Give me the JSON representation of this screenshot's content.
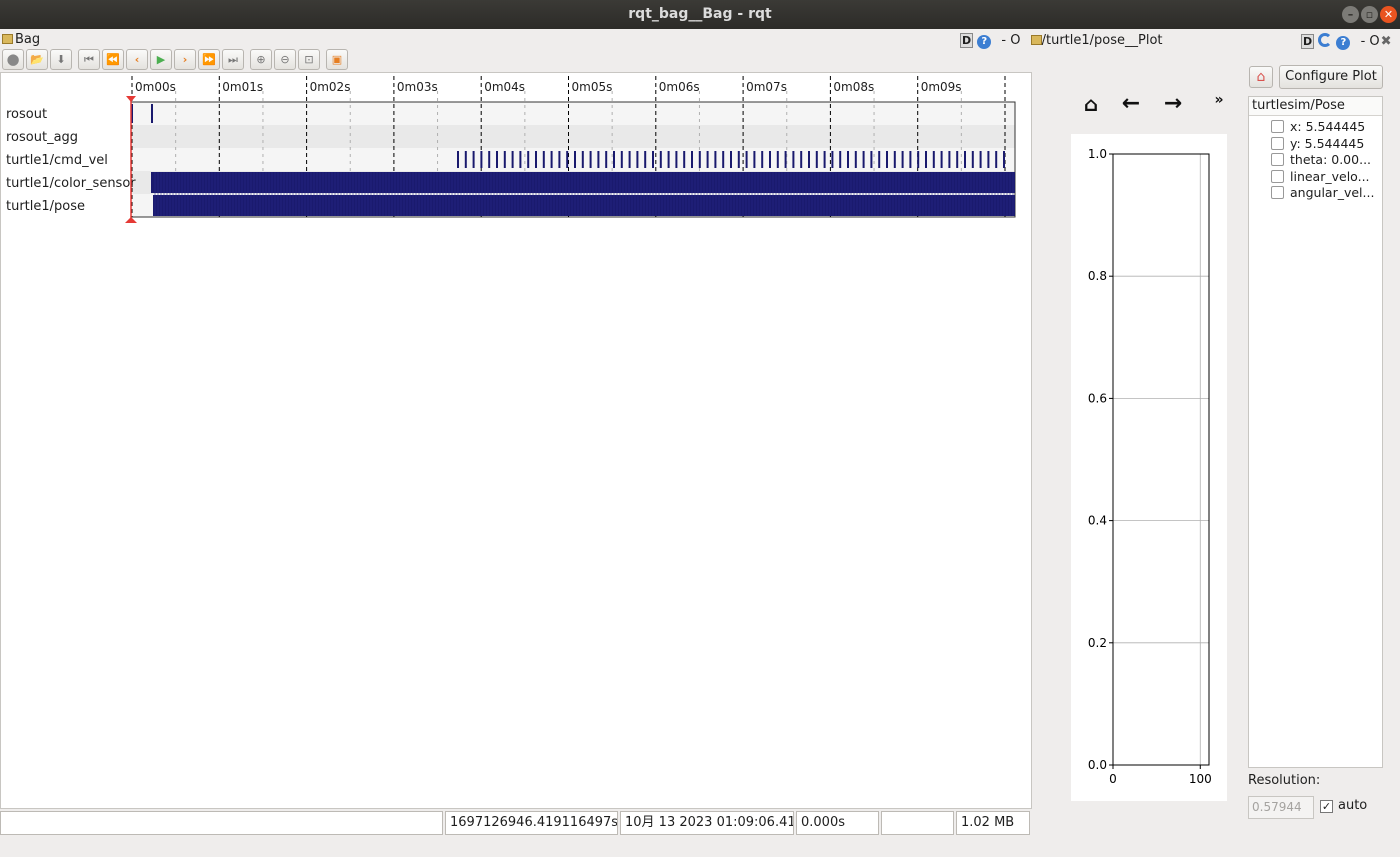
{
  "window": {
    "title": "rqt_bag__Bag - rqt"
  },
  "bag": {
    "pane_title": "Bag",
    "timeline": {
      "tick_labels": [
        "0m00s",
        "0m01s",
        "0m02s",
        "0m03s",
        "0m04s",
        "0m05s",
        "0m06s",
        "0m07s",
        "0m08s",
        "0m09s"
      ],
      "topics": [
        "rosout",
        "rosout_agg",
        "turtle1/cmd_vel",
        "turtle1/color_sensor",
        "turtle1/pose"
      ]
    },
    "status": {
      "message": "",
      "timestamp": "1697126946.419116497s",
      "date": "10月 13 2023 01:09:06.419",
      "playhead": "0.000s",
      "rate": "",
      "size": "1.02 MB"
    }
  },
  "plot": {
    "pane_title": "/turtle1/pose__Plot",
    "header_dash": "- O",
    "chart": {
      "y_ticks": [
        "0.0",
        "0.2",
        "0.4",
        "0.6",
        "0.8",
        "1.0"
      ],
      "x_ticks": [
        "0",
        "100"
      ]
    }
  },
  "config": {
    "configure_label": "Configure Plot",
    "tree_header": "turtlesim/Pose",
    "fields": [
      "x:  5.544445",
      "y:  5.544445",
      "theta:  0.00...",
      "linear_velo...",
      "angular_vel..."
    ],
    "resolution_label": "Resolution:",
    "resolution_value": "0.57944",
    "auto_label": "auto",
    "header_dash": "- O"
  },
  "colors": {
    "message_bar": "#1a1a6e",
    "playhead": "#e53935",
    "accent": "#e95420"
  },
  "chart_data": {
    "type": "line",
    "title": "",
    "xlabel": "",
    "ylabel": "",
    "xlim": [
      0,
      110
    ],
    "ylim": [
      0,
      1.0
    ],
    "x_ticks": [
      0,
      100
    ],
    "y_ticks": [
      0.0,
      0.2,
      0.4,
      0.6,
      0.8,
      1.0
    ],
    "grid": true,
    "series": []
  }
}
